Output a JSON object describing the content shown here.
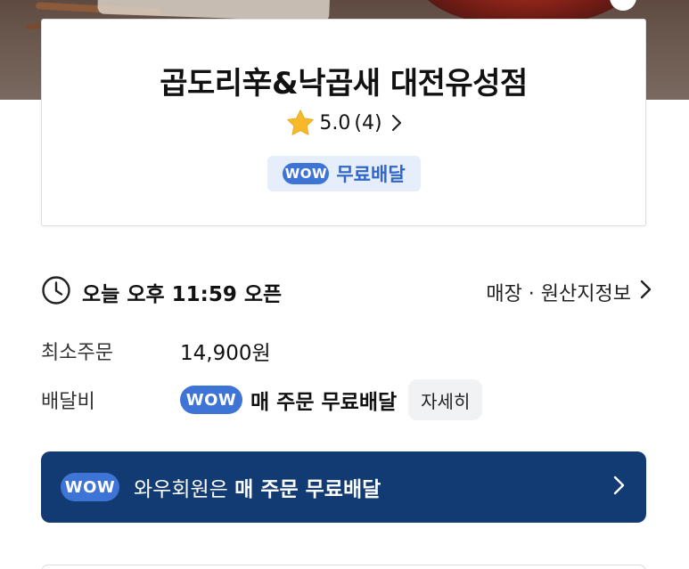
{
  "store": {
    "name": "곱도리辛&낙곱새 대전유성점",
    "rating": "5.0",
    "review_count": "(4)",
    "wow_badge": "WOW",
    "free_delivery": "무료배달"
  },
  "hours": {
    "text": "오늘 오후 11:59 오픈",
    "store_info_link": "매장 · 원산지정보"
  },
  "min_order": {
    "label": "최소주문",
    "value": "14,900원"
  },
  "delivery_fee": {
    "label": "배달비",
    "wow_badge": "WOW",
    "value": "매 주문 무료배달",
    "detail_button": "자세히"
  },
  "banner": {
    "wow_badge": "WOW",
    "prefix": "와우회원은",
    "highlight": "매 주문 무료배달"
  },
  "colors": {
    "wow_blue": "#3d74d6",
    "banner_navy": "#123b73",
    "chip_bg": "#e6eefb",
    "star": "#f7b829"
  }
}
